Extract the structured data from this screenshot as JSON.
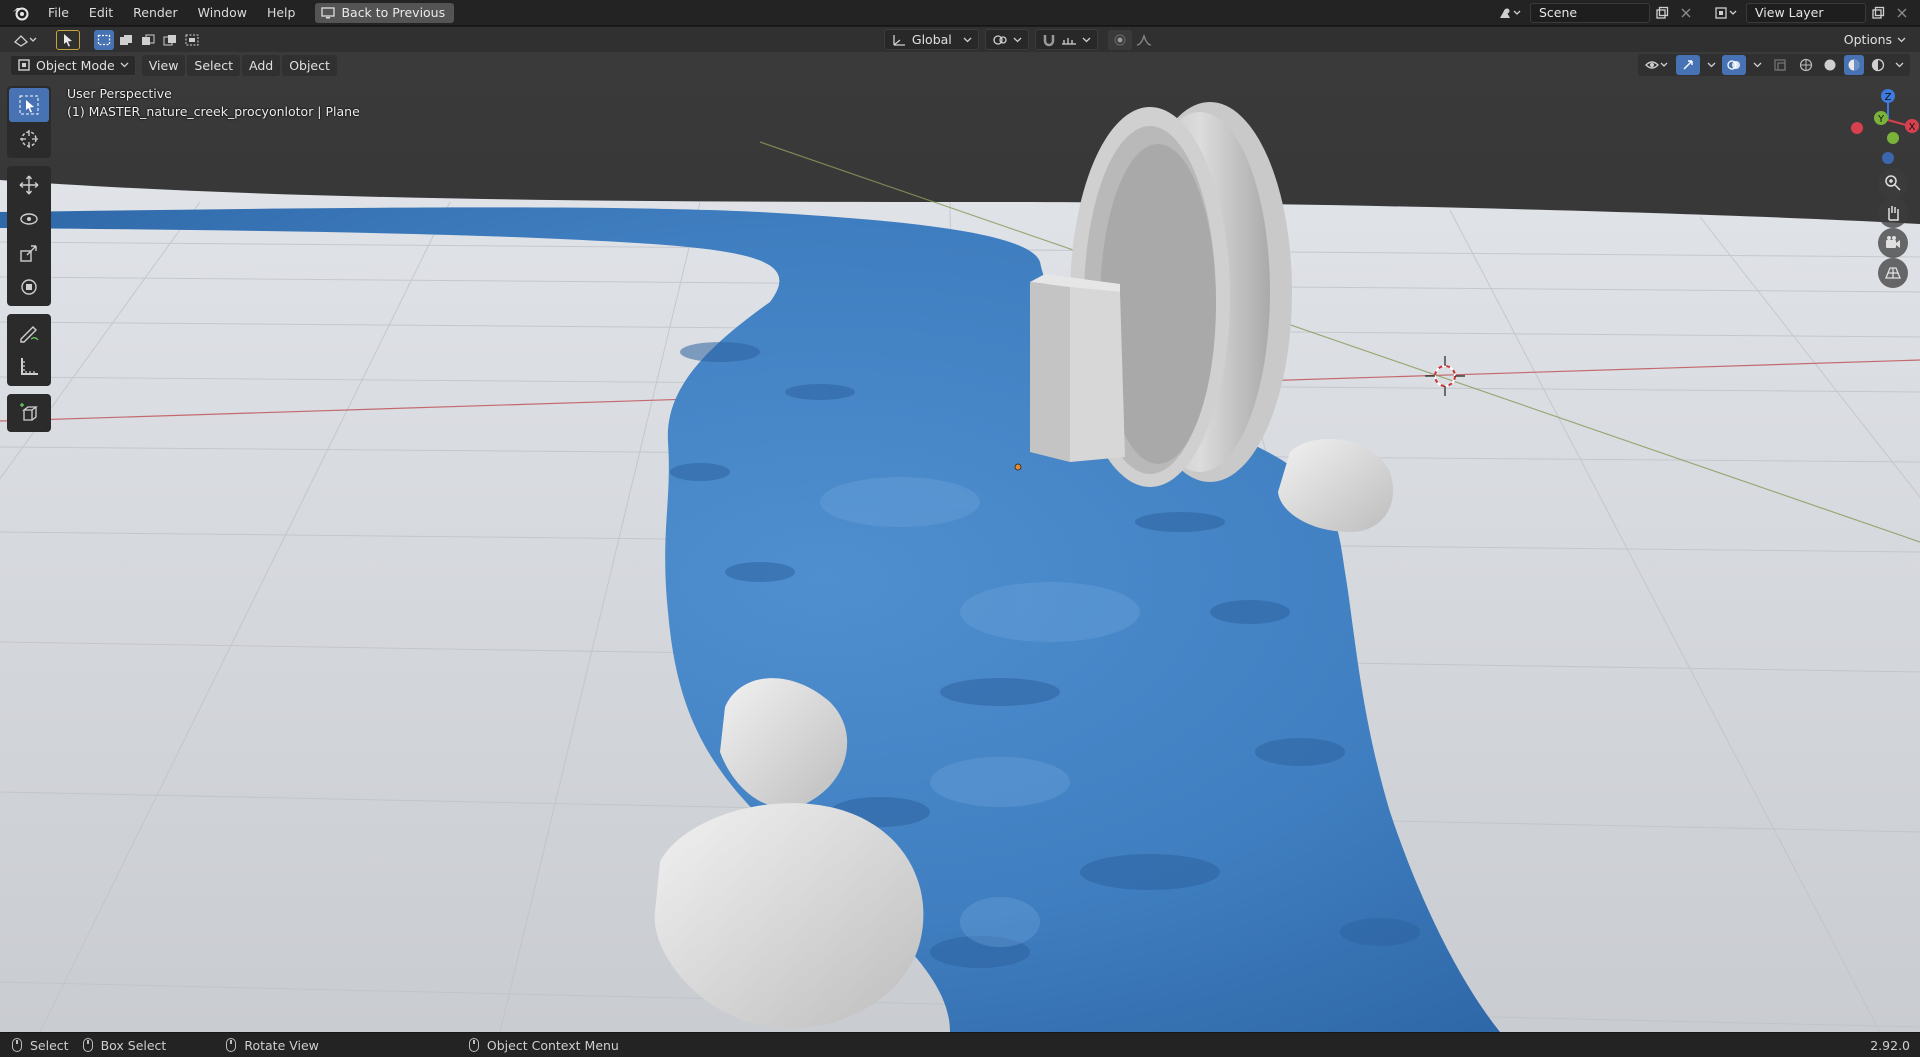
{
  "topbar": {
    "menus": [
      "File",
      "Edit",
      "Render",
      "Window",
      "Help"
    ],
    "back_button": "Back to Previous",
    "scene_value": "Scene",
    "view_layer_value": "View Layer"
  },
  "toolbar": {
    "transform_orientation": "Global",
    "options_label": "Options"
  },
  "header": {
    "mode": "Object Mode",
    "menus": [
      "View",
      "Select",
      "Add",
      "Object"
    ]
  },
  "viewport": {
    "perspective_label": "User Perspective",
    "object_label": "(1) MASTER_nature_creek_procyonlotor | Plane",
    "gizmo_axes": {
      "z": "Z",
      "y": "Y",
      "x": "X"
    },
    "colors": {
      "water": "#3f7ec0",
      "ground": "#d4d7dc",
      "sky": "#393939",
      "active_tool": "#4772b3"
    }
  },
  "statusbar": {
    "items": [
      "Select",
      "Box Select",
      "Rotate View",
      "Object Context Menu"
    ],
    "version": "2.92.0"
  }
}
